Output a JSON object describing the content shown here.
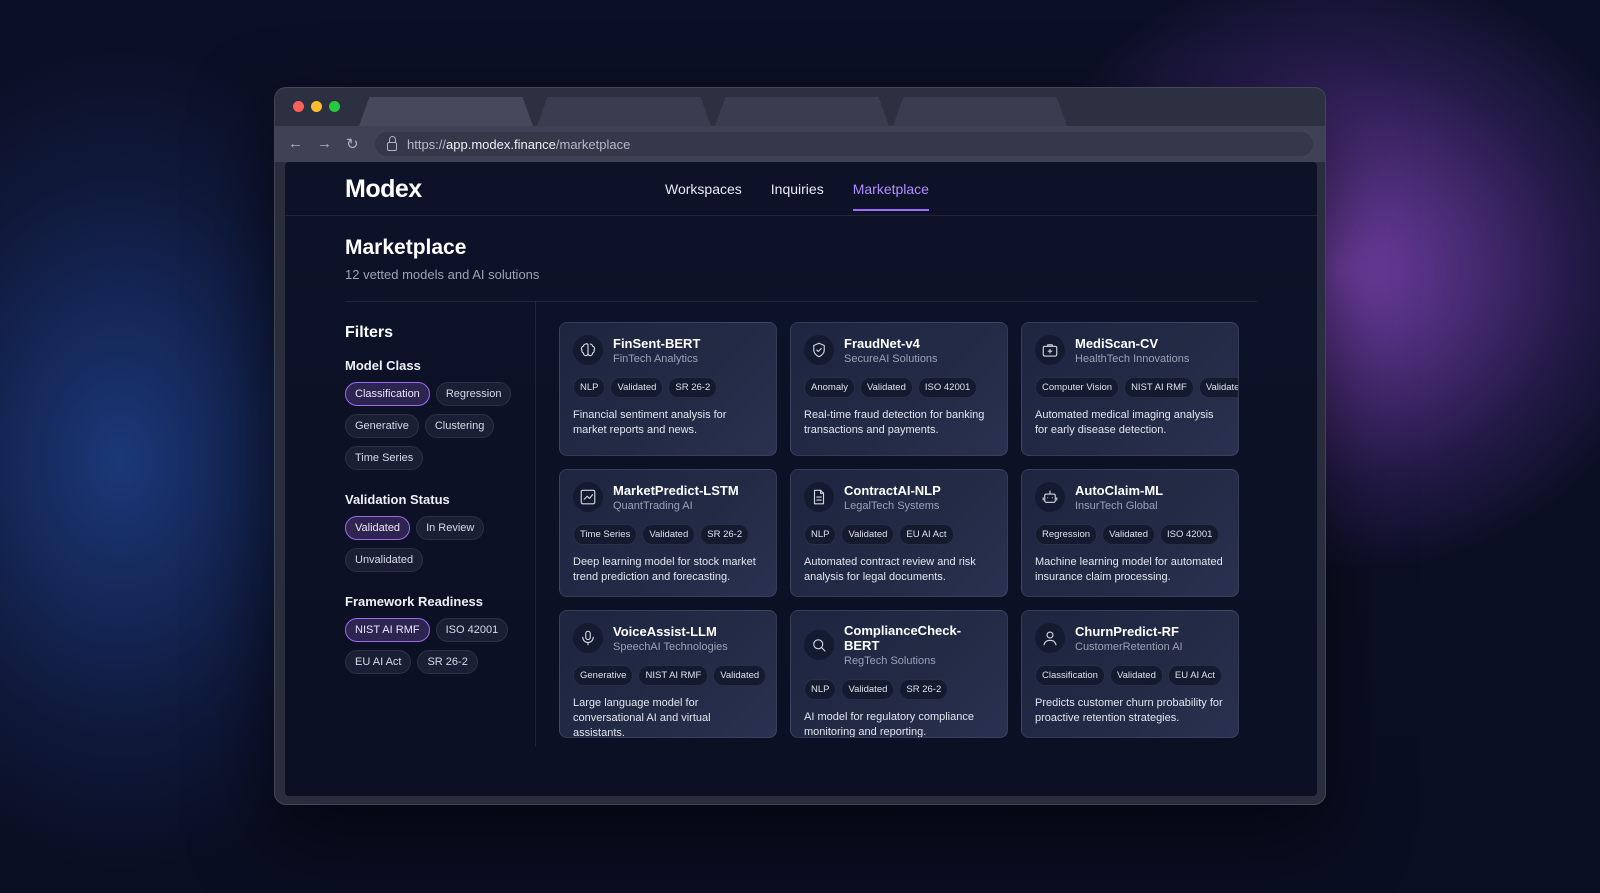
{
  "browser": {
    "url_prefix": "https://",
    "url_host": "app.modex.finance",
    "url_path": "/marketplace",
    "back_icon": "arrow-left-icon",
    "forward_icon": "arrow-right-icon",
    "reload_icon": "reload-icon"
  },
  "app": {
    "logo": "Modex",
    "nav": [
      {
        "label": "Workspaces"
      },
      {
        "label": "Inquiries"
      },
      {
        "label": "Marketplace"
      }
    ],
    "active_color": "#9a6cff"
  },
  "header": {
    "title": "Marketplace",
    "subtitle": "12 vetted models and AI solutions"
  },
  "filters": {
    "title": "Filters",
    "groups": [
      {
        "title": "Model Class",
        "options": [
          "Classification",
          "Regression",
          "Generative",
          "Clustering",
          "Time Series"
        ],
        "selected": "Classification"
      },
      {
        "title": "Validation Status",
        "options": [
          "Validated",
          "In Review",
          "Unvalidated"
        ],
        "selected": "Validated"
      },
      {
        "title": "Framework Readiness",
        "options": [
          "NIST AI RMF",
          "ISO 42001",
          "EU AI Act",
          "SR 26-2"
        ],
        "selected": "NIST AI RMF"
      }
    ]
  },
  "cards": [
    {
      "icon": "brain-icon",
      "title": "FinSent-BERT",
      "company": "FinTech Analytics",
      "tags": [
        "NLP",
        "Validated",
        "SR 26-2"
      ],
      "description": "Financial sentiment analysis for market reports and news."
    },
    {
      "icon": "shield-icon",
      "title": "FraudNet-v4",
      "company": "SecureAI Solutions",
      "tags": [
        "Anomaly",
        "Validated",
        "ISO 42001"
      ],
      "description": "Real-time fraud detection for banking transactions and payments."
    },
    {
      "icon": "medical-kit-icon",
      "title": "MediScan-CV",
      "company": "HealthTech Innovations",
      "tags": [
        "Computer Vision",
        "NIST AI RMF",
        "Validated"
      ],
      "description": "Automated medical imaging analysis for early disease detection."
    },
    {
      "icon": "chart-icon",
      "title": "MarketPredict-LSTM",
      "company": "QuantTrading AI",
      "tags": [
        "Time Series",
        "Validated",
        "SR 26-2"
      ],
      "description": "Deep learning model for stock market trend prediction and forecasting."
    },
    {
      "icon": "document-icon",
      "title": "ContractAI-NLP",
      "company": "LegalTech Systems",
      "tags": [
        "NLP",
        "Validated",
        "EU AI Act"
      ],
      "description": "Automated contract review and risk analysis for legal documents."
    },
    {
      "icon": "robot-icon",
      "title": "AutoClaim-ML",
      "company": "InsurTech Global",
      "tags": [
        "Regression",
        "Validated",
        "ISO 42001"
      ],
      "description": "Machine learning model for automated insurance claim processing."
    },
    {
      "icon": "microphone-icon",
      "title": "VoiceAssist-LLM",
      "company": "SpeechAI Technologies",
      "tags": [
        "Generative",
        "NIST AI RMF",
        "Validated"
      ],
      "description": "Large language model for conversational AI and virtual assistants."
    },
    {
      "icon": "search-icon",
      "title": "ComplianceCheck-BERT",
      "company": "RegTech Solutions",
      "tags": [
        "NLP",
        "Validated",
        "SR 26-2"
      ],
      "description": "AI model for regulatory compliance monitoring and reporting."
    },
    {
      "icon": "user-icon",
      "title": "ChurnPredict-RF",
      "company": "CustomerRetention AI",
      "tags": [
        "Classification",
        "Validated",
        "EU AI Act"
      ],
      "description": "Predicts customer churn probability for proactive retention strategies."
    }
  ]
}
